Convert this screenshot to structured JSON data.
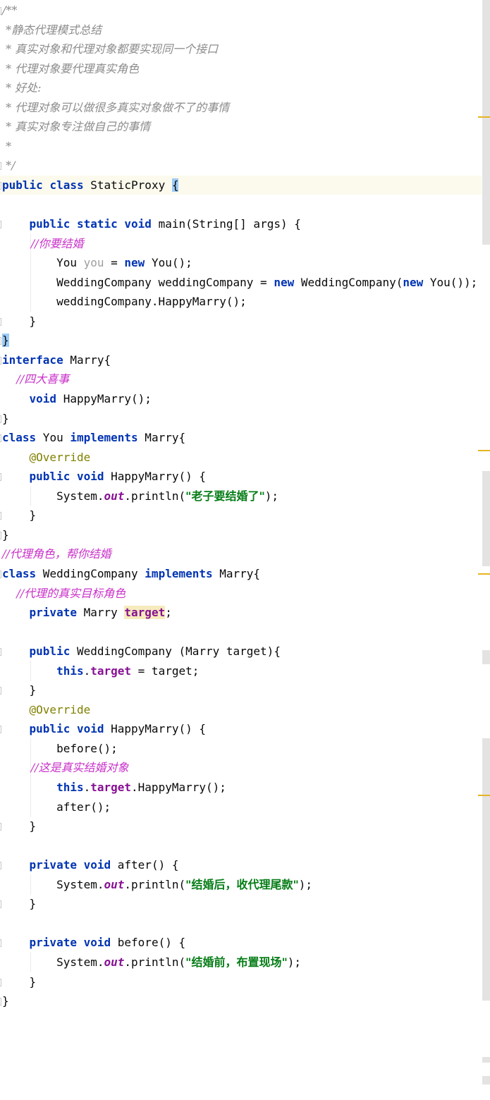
{
  "editor": {
    "lines": [
      {
        "text": "/**",
        "cls": "cm",
        "indent": 0
      },
      {
        "text": " *静态代理模式总结",
        "cls": "cm",
        "indent": 0
      },
      {
        "text": " * 真实对象和代理对象都要实现同一个接口",
        "cls": "cm",
        "indent": 0
      },
      {
        "text": " * 代理对象要代理真实角色",
        "cls": "cm",
        "indent": 0
      },
      {
        "text": " * 好处:",
        "cls": "cm",
        "indent": 0
      },
      {
        "text": " * 代理对象可以做很多真实对象做不了的事情",
        "cls": "cm",
        "indent": 0
      },
      {
        "text": " * 真实对象专注做自己的事情",
        "cls": "cm",
        "indent": 0
      },
      {
        "text": " *",
        "cls": "cm",
        "indent": 0
      },
      {
        "text": " */",
        "cls": "cm",
        "indent": 0
      },
      {
        "text": "public class StaticProxy {",
        "indent": 0
      },
      {
        "text": "",
        "indent": 0
      },
      {
        "text": "    public static void main(String[] args) {",
        "indent": 1
      },
      {
        "text": "        //你要结婚",
        "cls": "cm2",
        "indent": 2
      },
      {
        "text": "        You you = new You();",
        "indent": 2
      },
      {
        "text": "        WeddingCompany weddingCompany = new WeddingCompany(new You());",
        "indent": 2
      },
      {
        "text": "        weddingCompany.HappyMarry();",
        "indent": 2
      },
      {
        "text": "    }",
        "indent": 1
      },
      {
        "text": "}",
        "indent": 0
      },
      {
        "text": "interface Marry{",
        "indent": 0
      },
      {
        "text": "    //四大喜事",
        "cls": "cm2",
        "indent": 1
      },
      {
        "text": "    void HappyMarry();",
        "indent": 1
      },
      {
        "text": "}",
        "indent": 0
      },
      {
        "text": "class You implements Marry{",
        "indent": 0
      },
      {
        "text": "    @Override",
        "indent": 1
      },
      {
        "text": "    public void HappyMarry() {",
        "indent": 1
      },
      {
        "text": "        System.out.println(\"老子要结婚了\");",
        "indent": 2
      },
      {
        "text": "    }",
        "indent": 1
      },
      {
        "text": "}",
        "indent": 0
      },
      {
        "text": "//代理角色，帮你结婚",
        "cls": "cm2",
        "indent": 0
      },
      {
        "text": "class WeddingCompany implements Marry{",
        "indent": 0
      },
      {
        "text": "    //代理的真实目标角色",
        "cls": "cm2",
        "indent": 1
      },
      {
        "text": "    private Marry target;",
        "indent": 1
      },
      {
        "text": "",
        "indent": 0
      },
      {
        "text": "    public WeddingCompany (Marry target){",
        "indent": 1
      },
      {
        "text": "        this.target = target;",
        "indent": 2
      },
      {
        "text": "    }",
        "indent": 1
      },
      {
        "text": "    @Override",
        "indent": 1
      },
      {
        "text": "    public void HappyMarry() {",
        "indent": 1
      },
      {
        "text": "        before();",
        "indent": 2
      },
      {
        "text": "        //这是真实结婚对象",
        "cls": "cm2",
        "indent": 2
      },
      {
        "text": "        this.target.HappyMarry();",
        "indent": 2
      },
      {
        "text": "        after();",
        "indent": 2
      },
      {
        "text": "    }",
        "indent": 1
      },
      {
        "text": "",
        "indent": 0
      },
      {
        "text": "    private void after() {",
        "indent": 1
      },
      {
        "text": "        System.out.println(\"结婚后，收代理尾款\");",
        "indent": 2
      },
      {
        "text": "    }",
        "indent": 1
      },
      {
        "text": "",
        "indent": 0
      },
      {
        "text": "    private void before() {",
        "indent": 1
      },
      {
        "text": "        System.out.println(\"结婚前，布置现场\");",
        "indent": 2
      },
      {
        "text": "    }",
        "indent": 1
      },
      {
        "text": "}",
        "indent": 0
      }
    ]
  },
  "colors": {
    "keyword": "#0033b3",
    "string": "#067d17",
    "comment_doc": "#8c8c8c",
    "comment_line": "#c930c8",
    "annotation": "#808000",
    "field": "#871094",
    "current_line": "#fcfaed",
    "brace_match": "#9ccaf5",
    "usage_highlight": "#f6ebbc",
    "scroll_marker": "#e6b422"
  }
}
